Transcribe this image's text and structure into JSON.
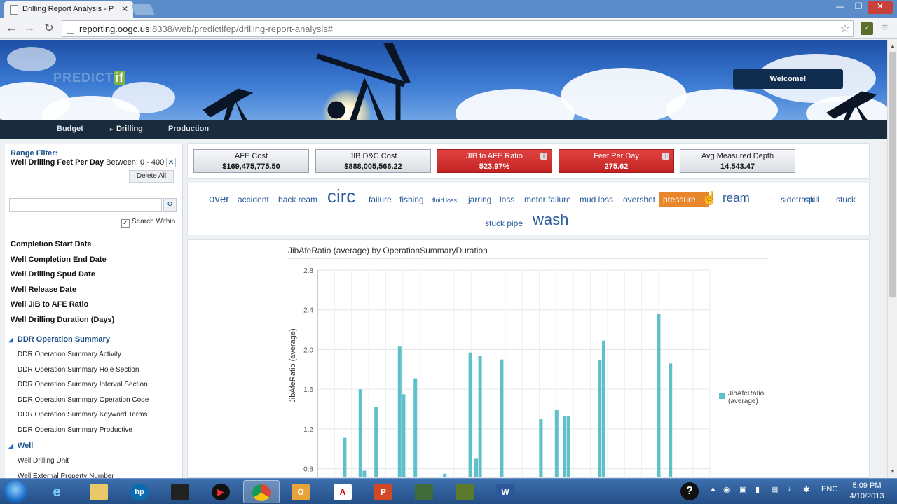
{
  "browser": {
    "tab_title": "Drilling Report Analysis - P",
    "url_host": "reporting.oogc.us",
    "url_path": ":8338/web/predictifep/drilling-report-analysis#"
  },
  "banner": {
    "logo_text": "PREDICT",
    "logo_suffix": "if",
    "welcome_label": "Welcome!"
  },
  "nav": {
    "items": [
      {
        "label": "Budget"
      },
      {
        "label": "Drilling",
        "active": true
      },
      {
        "label": "Production"
      }
    ]
  },
  "filters": {
    "range_title": "Range Filter:",
    "range_field": "Well Drilling Feet Per Day",
    "range_value": " Between: 0 - 400",
    "delete_all": "Delete All",
    "search_placeholder": "",
    "search_within": "Search Within",
    "fields": [
      "Completion Start Date",
      "Well Completion End Date",
      "Well Drilling Spud Date",
      "Well Release Date",
      "Well JIB to AFE Ratio",
      "Well Drilling Duration (Days)"
    ],
    "group1": {
      "label": "DDR Operation Summary",
      "items": [
        "DDR Operation Summary Activity",
        "DDR Operation Summary Hole Section",
        "DDR Operation Summary Interval Section",
        "DDR Operation Summary Operation Code",
        "DDR Operation Summary Keyword Terms",
        "DDR Operation Summary Productive"
      ]
    },
    "group2": {
      "label": "Well",
      "items": [
        "Well Drilling Unit",
        "Well External Property Number"
      ]
    }
  },
  "kpis": [
    {
      "label": "AFE Cost",
      "value": "$169,475,775.50",
      "status": "normal"
    },
    {
      "label": "JIB D&C Cost",
      "value": "$888,005,566.22",
      "status": "normal"
    },
    {
      "label": "JIB to AFE Ratio",
      "value": "523.97%",
      "status": "alert"
    },
    {
      "label": "Feet Per Day",
      "value": "275.62",
      "status": "alert"
    },
    {
      "label": "Avg Measured Depth",
      "value": "14,543.47",
      "status": "normal"
    }
  ],
  "keywords": [
    {
      "text": "over"
    },
    {
      "text": "accident"
    },
    {
      "text": "back ream"
    },
    {
      "text": "circ"
    },
    {
      "text": "failure"
    },
    {
      "text": "fishing"
    },
    {
      "text": "fluid loss"
    },
    {
      "text": "jarring"
    },
    {
      "text": "loss"
    },
    {
      "text": "motor failure"
    },
    {
      "text": "mud loss"
    },
    {
      "text": "overshot"
    },
    {
      "text": "pressure ...",
      "highlighted": true
    },
    {
      "text": "ream"
    },
    {
      "text": "sidetrack"
    },
    {
      "text": "spill"
    },
    {
      "text": "stuck"
    },
    {
      "text": "stuck pipe"
    },
    {
      "text": "wash"
    }
  ],
  "chart_data": {
    "type": "bar",
    "title": "JibAfeRatio (average) by OperationSummaryDuration",
    "ylabel": "JibAfeRatio (average)",
    "xlabel": "",
    "ylim": [
      0.6,
      2.8
    ],
    "yticks": [
      0.8,
      1.2,
      1.6,
      2.0,
      2.4,
      2.8
    ],
    "grid": true,
    "legend": "right",
    "series": [
      {
        "name": "JibAfeRatio (average)",
        "color": "#5ec1c9",
        "values": [
          1.11,
          1.6,
          0.78,
          1.42,
          2.03,
          1.55,
          1.71,
          0.75,
          1.97,
          0.9,
          1.94,
          1.9,
          1.3,
          1.39,
          1.33,
          1.33,
          1.89,
          2.09,
          2.36,
          1.86
        ]
      }
    ]
  },
  "taskbar": {
    "language": "ENG",
    "time": "5:09 PM",
    "date": "4/10/2013"
  },
  "colors": {
    "accent": "#1b4f8a",
    "alert": "#d12c2c",
    "bar": "#5ec1c9",
    "highlight": "#e8862c"
  }
}
